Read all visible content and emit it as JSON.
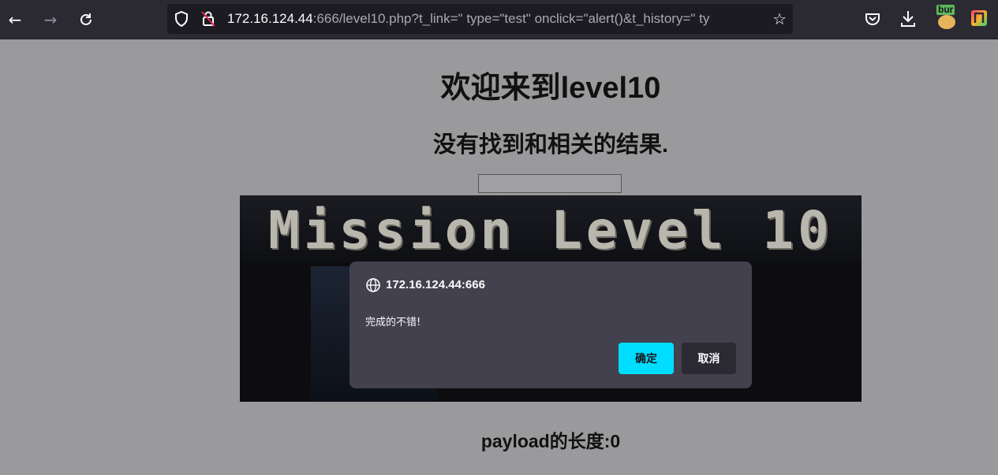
{
  "browser": {
    "url_host": "172.16.124.44",
    "url_rest": ":666/level10.php?t_link=\" type=\"test\" onclick=\"alert()&t_history=\" ty",
    "ext_burp_label": "bur"
  },
  "page": {
    "heading": "欢迎来到level10",
    "result_text": "没有找到和相关的结果.",
    "banner_text": "Mission Level 10",
    "payload_length": "payload的长度:0"
  },
  "dialog": {
    "origin": "172.16.124.44:666",
    "message": "完成的不错!",
    "ok_label": "确定",
    "cancel_label": "取消"
  },
  "colors": {
    "accent": "#00ddff",
    "toolbar": "#2b2a33",
    "page_bg": "#9a9a9c"
  }
}
